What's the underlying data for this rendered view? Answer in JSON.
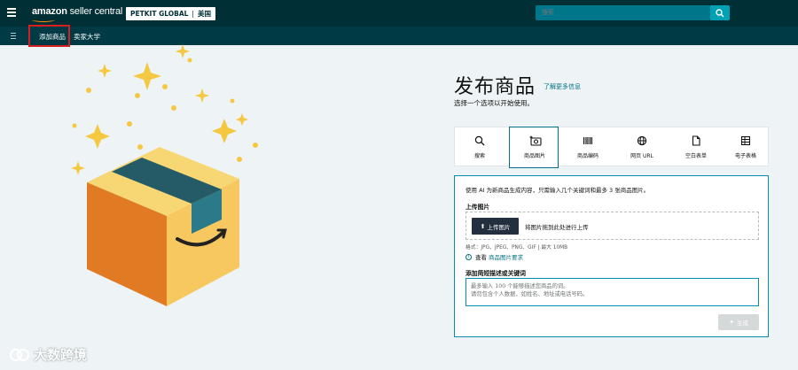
{
  "topbar": {
    "logo_bold": "amazon",
    "logo_thin": " seller central",
    "account_name": "PETKIT GLOBAL",
    "account_region": "美国",
    "search_placeholder": "搜索"
  },
  "subnav": {
    "items": [
      {
        "label": "添加商品"
      },
      {
        "label": "卖家大学"
      }
    ]
  },
  "main": {
    "title": "发布商品",
    "learn_more": "了解更多信息",
    "subtitle": "选择一个选项以开始使用。",
    "tabs": [
      {
        "label": "搜索",
        "icon": "search-icon"
      },
      {
        "label": "商品图片",
        "icon": "camera-sparkle-icon",
        "active": true
      },
      {
        "label": "商品编码",
        "icon": "barcode-icon"
      },
      {
        "label": "网页 URL",
        "icon": "globe-icon"
      },
      {
        "label": "空白表单",
        "icon": "document-icon"
      },
      {
        "label": "电子表格",
        "icon": "spreadsheet-icon"
      }
    ]
  },
  "form": {
    "description": "使用 AI 为新商品生成内容，只需输入几个关键词和最多 3 张商品图片。",
    "upload_label": "上传图片",
    "upload_button": "上传图片",
    "drop_text": "将图片拖到此处进行上传",
    "formats": "格式：JPG、JPEG、PNG、GIF | 最大 10MB",
    "view_prefix": "查看",
    "view_link": "商品图片要求",
    "keyword_label": "添加简短描述或关键词",
    "keyword_placeholder_1": "最多输入 100 个能够描述您商品的词。",
    "keyword_placeholder_2": "请勿包含个人数据，如姓名、地址或电话号码。",
    "generate_button": "生成"
  },
  "watermark": {
    "text": "大数跨境"
  },
  "colors": {
    "topbar": "#002f36",
    "accent": "#007185",
    "highlight": "#d61f1f"
  }
}
